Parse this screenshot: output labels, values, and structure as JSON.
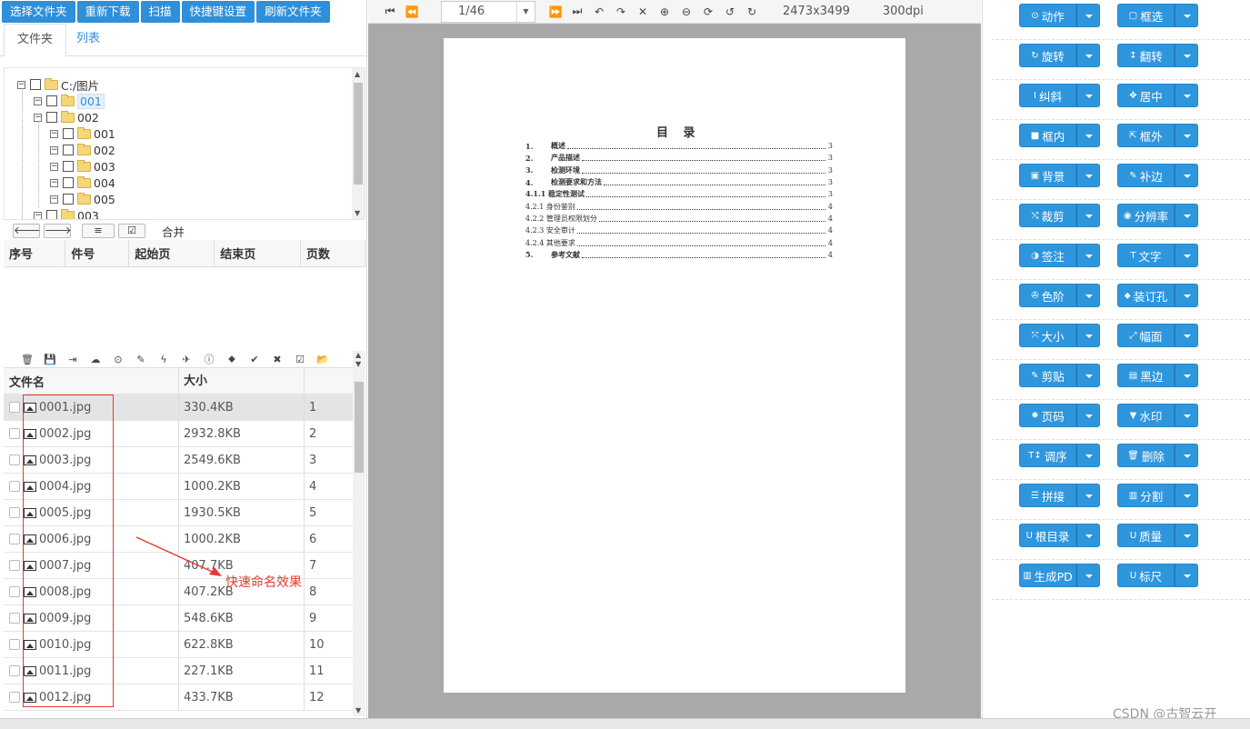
{
  "top_buttons": [
    "选择文件夹",
    "重新下载",
    "扫描",
    "快捷键设置",
    "刷新文件夹"
  ],
  "tabs": {
    "folder": "文件夹",
    "list": "列表"
  },
  "tree": [
    {
      "label": "C:/图片",
      "level": 0
    },
    {
      "label": "001",
      "level": 1,
      "selected": true
    },
    {
      "label": "002",
      "level": 1
    },
    {
      "label": "001",
      "level": 2
    },
    {
      "label": "002",
      "level": 2
    },
    {
      "label": "003",
      "level": 2
    },
    {
      "label": "004",
      "level": 2
    },
    {
      "label": "005",
      "level": 2
    },
    {
      "label": "003",
      "level": 1
    }
  ],
  "nav": {
    "prev": "🡐",
    "next": "🡒",
    "list_icon": "≡",
    "check_icon": "☑",
    "merge": "合并"
  },
  "docs_table": {
    "headers": [
      "序号",
      "件号",
      "起始页",
      "结束页",
      "页数"
    ]
  },
  "file_icons": [
    "trash-icon",
    "save-icon",
    "import-icon",
    "cloud-upload-icon",
    "download-icon",
    "edit-icon",
    "bolt-icon",
    "plane-icon",
    "info-icon",
    "tags-icon",
    "check-icon",
    "close-icon",
    "check-square-icon",
    "folder-open-icon"
  ],
  "files": {
    "headers": [
      "文件名",
      "大小",
      ""
    ],
    "rows": [
      {
        "name": "0001.jpg",
        "size": "330.4KB",
        "idx": "1",
        "selected": true
      },
      {
        "name": "0002.jpg",
        "size": "2932.8KB",
        "idx": "2"
      },
      {
        "name": "0003.jpg",
        "size": "2549.6KB",
        "idx": "3"
      },
      {
        "name": "0004.jpg",
        "size": "1000.2KB",
        "idx": "4"
      },
      {
        "name": "0005.jpg",
        "size": "1930.5KB",
        "idx": "5"
      },
      {
        "name": "0006.jpg",
        "size": "1000.2KB",
        "idx": "6"
      },
      {
        "name": "0007.jpg",
        "size": "407.7KB",
        "idx": "7"
      },
      {
        "name": "0008.jpg",
        "size": "407.2KB",
        "idx": "8"
      },
      {
        "name": "0009.jpg",
        "size": "548.6KB",
        "idx": "9"
      },
      {
        "name": "0010.jpg",
        "size": "622.8KB",
        "idx": "10"
      },
      {
        "name": "0011.jpg",
        "size": "227.1KB",
        "idx": "11"
      },
      {
        "name": "0012.jpg",
        "size": "433.7KB",
        "idx": "12"
      }
    ]
  },
  "annotation": "快速命名效果",
  "viewer": {
    "page_display": "1/46",
    "dimensions": "2473x3499",
    "dpi": "300dpi"
  },
  "document": {
    "title": "目 录",
    "toc": [
      {
        "num": "1.",
        "text": "概述",
        "page": "3",
        "sub": false
      },
      {
        "num": "2.",
        "text": "产品描述",
        "page": "3",
        "sub": false
      },
      {
        "num": "3.",
        "text": "检测环境",
        "page": "3",
        "sub": false
      },
      {
        "num": "4.",
        "text": "检测要求和方法",
        "page": "3",
        "sub": false
      },
      {
        "num": "",
        "text": "4.1.1 稳定性测试",
        "page": "3",
        "sub": false
      },
      {
        "num": "",
        "text": "4.2.1 身份鉴别",
        "page": "4",
        "sub": true
      },
      {
        "num": "",
        "text": "4.2.2 管理员权限划分",
        "page": "4",
        "sub": true
      },
      {
        "num": "",
        "text": "4.2.3 安全审计",
        "page": "4",
        "sub": true
      },
      {
        "num": "",
        "text": "4.2.4 其他要求",
        "page": "4",
        "sub": true
      },
      {
        "num": "5.",
        "text": "参考文献",
        "page": "4",
        "sub": false
      }
    ]
  },
  "tools": [
    [
      {
        "label": "动作",
        "icon": "⊙"
      },
      {
        "label": "框选",
        "icon": "▢"
      }
    ],
    [
      {
        "label": "旋转",
        "icon": "↻"
      },
      {
        "label": "翻转",
        "icon": "↕"
      }
    ],
    [
      {
        "label": "纠斜",
        "icon": "I"
      },
      {
        "label": "居中",
        "icon": "✥"
      }
    ],
    [
      {
        "label": "框内",
        "icon": "■"
      },
      {
        "label": "框外",
        "icon": "⇱"
      }
    ],
    [
      {
        "label": "背景",
        "icon": "▣"
      },
      {
        "label": "补边",
        "icon": "✎"
      }
    ],
    [
      {
        "label": "裁剪",
        "icon": "⤭"
      },
      {
        "label": "分辨率",
        "icon": "◉"
      }
    ],
    [
      {
        "label": "签注",
        "icon": "◑"
      },
      {
        "label": "文字",
        "icon": "T"
      }
    ],
    [
      {
        "label": "色阶",
        "icon": "✇"
      },
      {
        "label": "装订孔",
        "icon": "⬥"
      }
    ],
    [
      {
        "label": "大小",
        "icon": "⤧"
      },
      {
        "label": "幅面",
        "icon": "⤢"
      }
    ],
    [
      {
        "label": "剪贴",
        "icon": "✎"
      },
      {
        "label": "黑边",
        "icon": "▤"
      }
    ],
    [
      {
        "label": "页码",
        "icon": "✹"
      },
      {
        "label": "水印",
        "icon": "▼"
      }
    ],
    [
      {
        "label": "调序",
        "icon": "T↕"
      },
      {
        "label": "删除",
        "icon": "🗑"
      }
    ],
    [
      {
        "label": "拼接",
        "icon": "☰"
      },
      {
        "label": "分割",
        "icon": "▥"
      }
    ],
    [
      {
        "label": "根目录",
        "icon": "U"
      },
      {
        "label": "质量",
        "icon": "U"
      }
    ],
    [
      {
        "label": "生成PD",
        "icon": "▥"
      },
      {
        "label": "标尺",
        "icon": "U"
      }
    ]
  ],
  "watermark": "CSDN @古智云开",
  "colors": {
    "accent": "#2e96dd",
    "annotation": "#e53935",
    "viewer_bg": "#a9a9a9"
  }
}
